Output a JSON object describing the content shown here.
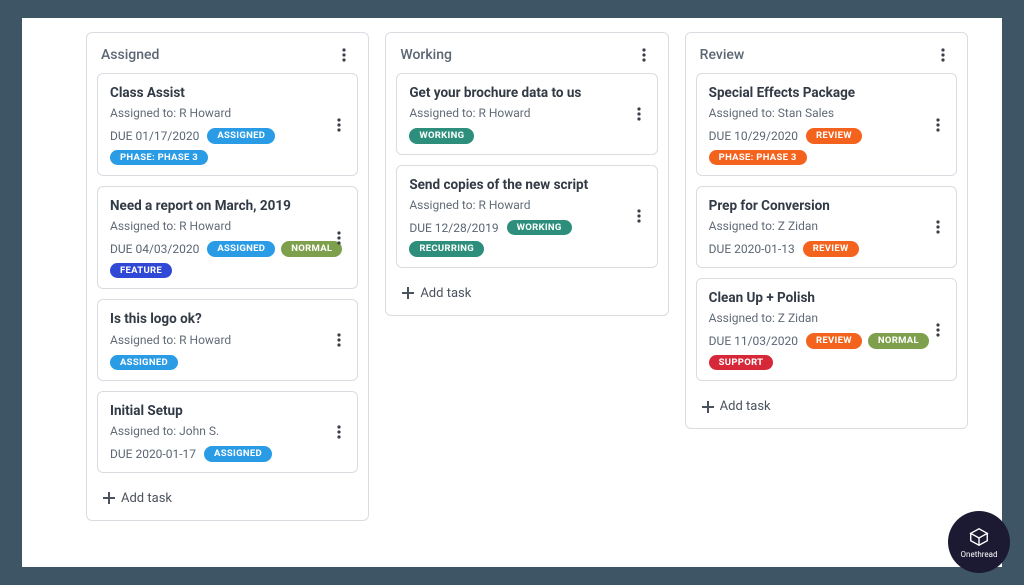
{
  "brand": {
    "name": "Onethread"
  },
  "add_task_label": "Add task",
  "columns": [
    {
      "title": "Assigned",
      "cards": [
        {
          "title": "Class Assist",
          "assigned": "Assigned to: R Howard",
          "due": "DUE 01/17/2020",
          "pills": [
            {
              "text": "ASSIGNED",
              "color": "blue"
            },
            {
              "text": "PHASE: PHASE 3",
              "color": "blue"
            }
          ]
        },
        {
          "title": "Need a report on March, 2019",
          "assigned": "Assigned to: R Howard",
          "due": "DUE 04/03/2020",
          "pills": [
            {
              "text": "ASSIGNED",
              "color": "blue"
            },
            {
              "text": "NORMAL",
              "color": "olive"
            },
            {
              "text": "FEATURE",
              "color": "indigo"
            }
          ]
        },
        {
          "title": "Is this logo ok?",
          "assigned": "Assigned to: R Howard",
          "due": "",
          "pills": [
            {
              "text": "ASSIGNED",
              "color": "blue"
            }
          ]
        },
        {
          "title": "Initial Setup",
          "assigned": "Assigned to: John S.",
          "due": "DUE 2020-01-17",
          "pills": [
            {
              "text": "ASSIGNED",
              "color": "blue"
            }
          ]
        }
      ]
    },
    {
      "title": "Working",
      "cards": [
        {
          "title": "Get your brochure data to us",
          "assigned": "Assigned to: R Howard",
          "due": "",
          "pills": [
            {
              "text": "WORKING",
              "color": "teal"
            }
          ]
        },
        {
          "title": "Send copies of the new script",
          "assigned": "Assigned to: R Howard",
          "due": "DUE 12/28/2019",
          "pills": [
            {
              "text": "WORKING",
              "color": "teal"
            },
            {
              "text": "RECURRING",
              "color": "teal"
            }
          ]
        }
      ]
    },
    {
      "title": "Review",
      "cards": [
        {
          "title": "Special Effects Package",
          "assigned": "Assigned to: Stan Sales",
          "due": "DUE 10/29/2020",
          "pills": [
            {
              "text": "REVIEW",
              "color": "orange"
            },
            {
              "text": "PHASE: PHASE 3",
              "color": "orange"
            }
          ]
        },
        {
          "title": "Prep for Conversion",
          "assigned": "Assigned to: Z Zidan",
          "due": "DUE 2020-01-13",
          "pills": [
            {
              "text": "REVIEW",
              "color": "orange"
            }
          ]
        },
        {
          "title": "Clean Up + Polish",
          "assigned": "Assigned to: Z Zidan",
          "due": "DUE 11/03/2020",
          "pills": [
            {
              "text": "REVIEW",
              "color": "orange"
            },
            {
              "text": "NORMAL",
              "color": "olive"
            },
            {
              "text": "SUPPORT",
              "color": "red"
            }
          ]
        }
      ]
    }
  ]
}
